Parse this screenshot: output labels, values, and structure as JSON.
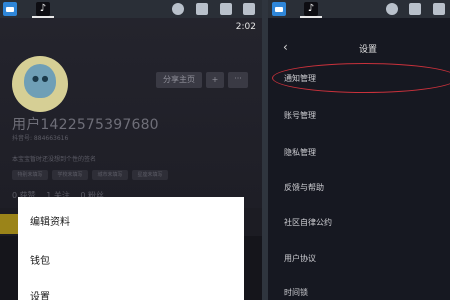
{
  "left_panel": {
    "time": "2:02",
    "tab_icon_glyph": "♪",
    "profile": {
      "share_button": "分享主页",
      "add_friend_glyph": "+",
      "more_glyph": "···",
      "username": "用户1422575397680",
      "douyin_id": "抖音号: 884663616",
      "bio": "本宝宝暂时还没想到个性的签名",
      "tags": [
        "特别未填写",
        "学校未填写",
        "城市未填写",
        "星座未填写"
      ],
      "stats": [
        "0 获赞",
        "1 关注",
        "0 粉丝"
      ]
    },
    "menu": {
      "items": [
        "编辑资料",
        "钱包",
        "设置"
      ]
    }
  },
  "right_panel": {
    "tab_icon_glyph": "♪",
    "back_glyph": "‹",
    "title": "设置",
    "items": [
      "通知管理",
      "账号管理",
      "隐私管理",
      "反馈与帮助",
      "社区自律公约",
      "用户协议",
      "时间锁"
    ]
  },
  "icons": {
    "desktop_app": "desktop-app-icon",
    "tiktok_app": "tiktok-app-icon",
    "user": "user-icon",
    "shirt": "shirt-icon",
    "window": "window-icon",
    "minimize": "minimize-icon"
  },
  "colors": {
    "highlight": "#c8313b",
    "accent_yellow": "#9b8419"
  }
}
